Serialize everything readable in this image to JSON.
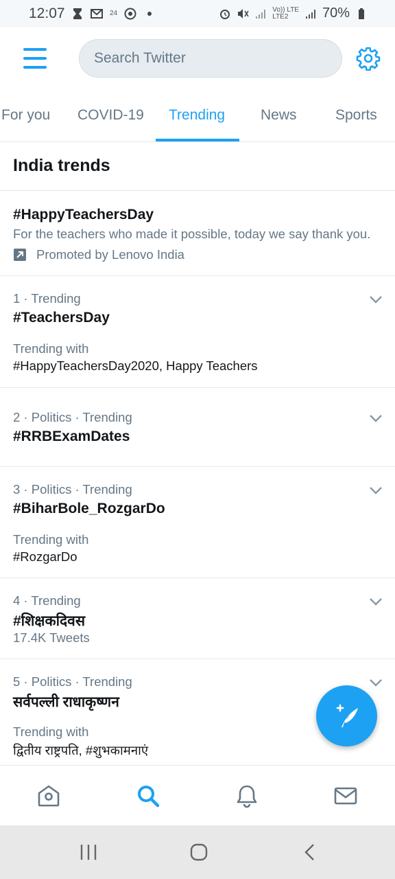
{
  "status_bar": {
    "time": "12:07",
    "notification_count_label": "24",
    "network_label_top": "Vo)) LTE",
    "network_label_bottom": "LTE2",
    "battery": "70%"
  },
  "header": {
    "search_placeholder": "Search Twitter"
  },
  "tabs": [
    {
      "label": "For you"
    },
    {
      "label": "COVID-19"
    },
    {
      "label": "Trending"
    },
    {
      "label": "News"
    },
    {
      "label": "Sports"
    }
  ],
  "active_tab": "Trending",
  "section_title": "India trends",
  "promoted": {
    "name": "#HappyTeachersDay",
    "description": "For the teachers who made it possible, today we say thank you.",
    "promoted_by": "Promoted by Lenovo India"
  },
  "trends": [
    {
      "meta": "1 · Trending",
      "name": "#TeachersDay",
      "with_label": "Trending with",
      "with_items": "#HappyTeachersDay2020, Happy Teachers"
    },
    {
      "meta": "2 · Politics · Trending",
      "name": "#RRBExamDates"
    },
    {
      "meta": "3 · Politics · Trending",
      "name": "#BiharBole_RozgarDo",
      "with_label": "Trending with",
      "with_items": "#RozgarDo"
    },
    {
      "meta": "4 · Trending",
      "name": "#शिक्षकदिवस",
      "tweets": "17.4K Tweets"
    },
    {
      "meta": "5 · Politics · Trending",
      "name": "सर्वपल्ली राधाकृष्णन",
      "with_label": "Trending with",
      "with_items": "द्वितीय राष्ट्रपति, #शुभकामनाएं"
    }
  ],
  "colors": {
    "accent": "#1da1f2",
    "secondary_text": "#657786",
    "primary_text": "#14171a",
    "divider": "#e1e8ed"
  },
  "icons": {
    "menu": "hamburger-icon",
    "settings": "gear-icon",
    "promoted": "promoted-arrow-icon",
    "chevron": "chevron-down-icon",
    "compose": "compose-tweet-icon",
    "home": "home-icon",
    "search": "search-icon",
    "notifications": "bell-icon",
    "messages": "mail-icon"
  }
}
